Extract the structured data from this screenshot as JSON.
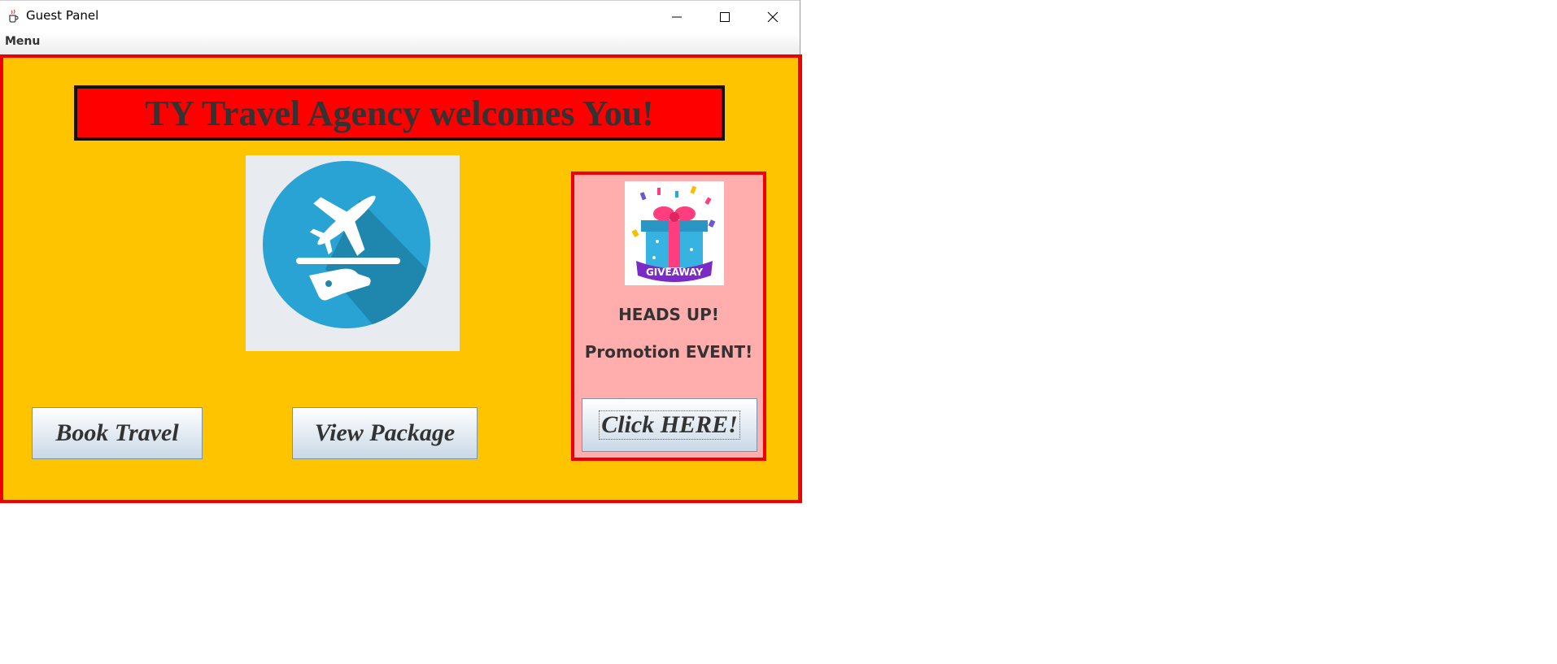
{
  "window": {
    "title": "Guest Panel",
    "icon": "java-cup-icon",
    "controls": [
      "minimize-icon",
      "maximize-icon",
      "close-icon"
    ]
  },
  "menubar": {
    "menu_label": "Menu"
  },
  "main": {
    "welcome": "TY Travel Agency welcomes You!",
    "logo_icon": "plane-on-hand-icon",
    "book_button": "Book Travel",
    "package_button": "View Package"
  },
  "promo": {
    "gift_icon": "giveaway-gift-icon",
    "gift_text": "GIVEAWAY",
    "heading": "HEADS UP!",
    "subheading": "Promotion EVENT!",
    "button": "Click HERE!"
  },
  "colors": {
    "background": "#ffc400",
    "frame": "#ee0000",
    "banner": "#ff0000",
    "promo_panel": "#ffadad",
    "logo_circle": "#29a3d3"
  }
}
